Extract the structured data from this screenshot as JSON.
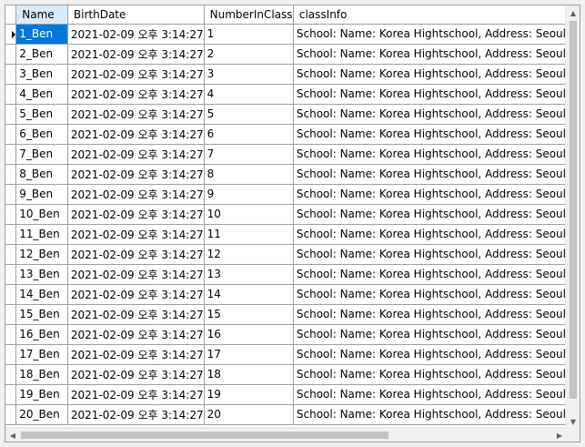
{
  "grid": {
    "columns": [
      "Name",
      "BirthDate",
      "NumberInClass",
      "classInfo"
    ],
    "rows": [
      {
        "name": "1_Ben",
        "birth": "2021-02-09 오후 3:14:27",
        "num": "1",
        "info": "School: Name: Korea Hightschool, Address: Seoul"
      },
      {
        "name": "2_Ben",
        "birth": "2021-02-09 오후 3:14:27",
        "num": "2",
        "info": "School: Name: Korea Hightschool, Address: Seoul"
      },
      {
        "name": "3_Ben",
        "birth": "2021-02-09 오후 3:14:27",
        "num": "3",
        "info": "School: Name: Korea Hightschool, Address: Seoul"
      },
      {
        "name": "4_Ben",
        "birth": "2021-02-09 오후 3:14:27",
        "num": "4",
        "info": "School: Name: Korea Hightschool, Address: Seoul"
      },
      {
        "name": "5_Ben",
        "birth": "2021-02-09 오후 3:14:27",
        "num": "5",
        "info": "School: Name: Korea Hightschool, Address: Seoul"
      },
      {
        "name": "6_Ben",
        "birth": "2021-02-09 오후 3:14:27",
        "num": "6",
        "info": "School: Name: Korea Hightschool, Address: Seoul"
      },
      {
        "name": "7_Ben",
        "birth": "2021-02-09 오후 3:14:27",
        "num": "7",
        "info": "School: Name: Korea Hightschool, Address: Seoul"
      },
      {
        "name": "8_Ben",
        "birth": "2021-02-09 오후 3:14:27",
        "num": "8",
        "info": "School: Name: Korea Hightschool, Address: Seoul"
      },
      {
        "name": "9_Ben",
        "birth": "2021-02-09 오후 3:14:27",
        "num": "9",
        "info": "School: Name: Korea Hightschool, Address: Seoul"
      },
      {
        "name": "10_Ben",
        "birth": "2021-02-09 오후 3:14:27",
        "num": "10",
        "info": "School: Name: Korea Hightschool, Address: Seoul"
      },
      {
        "name": "11_Ben",
        "birth": "2021-02-09 오후 3:14:27",
        "num": "11",
        "info": "School: Name: Korea Hightschool, Address: Seoul"
      },
      {
        "name": "12_Ben",
        "birth": "2021-02-09 오후 3:14:27",
        "num": "12",
        "info": "School: Name: Korea Hightschool, Address: Seoul"
      },
      {
        "name": "13_Ben",
        "birth": "2021-02-09 오후 3:14:27",
        "num": "13",
        "info": "School: Name: Korea Hightschool, Address: Seoul"
      },
      {
        "name": "14_Ben",
        "birth": "2021-02-09 오후 3:14:27",
        "num": "14",
        "info": "School: Name: Korea Hightschool, Address: Seoul"
      },
      {
        "name": "15_Ben",
        "birth": "2021-02-09 오후 3:14:27",
        "num": "15",
        "info": "School: Name: Korea Hightschool, Address: Seoul"
      },
      {
        "name": "16_Ben",
        "birth": "2021-02-09 오후 3:14:27",
        "num": "16",
        "info": "School: Name: Korea Hightschool, Address: Seoul"
      },
      {
        "name": "17_Ben",
        "birth": "2021-02-09 오후 3:14:27",
        "num": "17",
        "info": "School: Name: Korea Hightschool, Address: Seoul"
      },
      {
        "name": "18_Ben",
        "birth": "2021-02-09 오후 3:14:27",
        "num": "18",
        "info": "School: Name: Korea Hightschool, Address: Seoul"
      },
      {
        "name": "19_Ben",
        "birth": "2021-02-09 오후 3:14:27",
        "num": "19",
        "info": "School: Name: Korea Hightschool, Address: Seoul"
      },
      {
        "name": "20_Ben",
        "birth": "2021-02-09 오후 3:14:27",
        "num": "20",
        "info": "School: Name: Korea Hightschool, Address: Seoul"
      }
    ],
    "selected_row": 0
  },
  "icons": {
    "current_row": "row-pointer-icon",
    "scroll_up": "triangle-up-icon",
    "scroll_down": "triangle-down-icon",
    "scroll_left": "triangle-left-icon",
    "scroll_right": "triangle-right-icon"
  },
  "colors": {
    "selection": "#0078d7",
    "selected_header": "#d9ebf9",
    "gridline": "#a0a0a0"
  }
}
